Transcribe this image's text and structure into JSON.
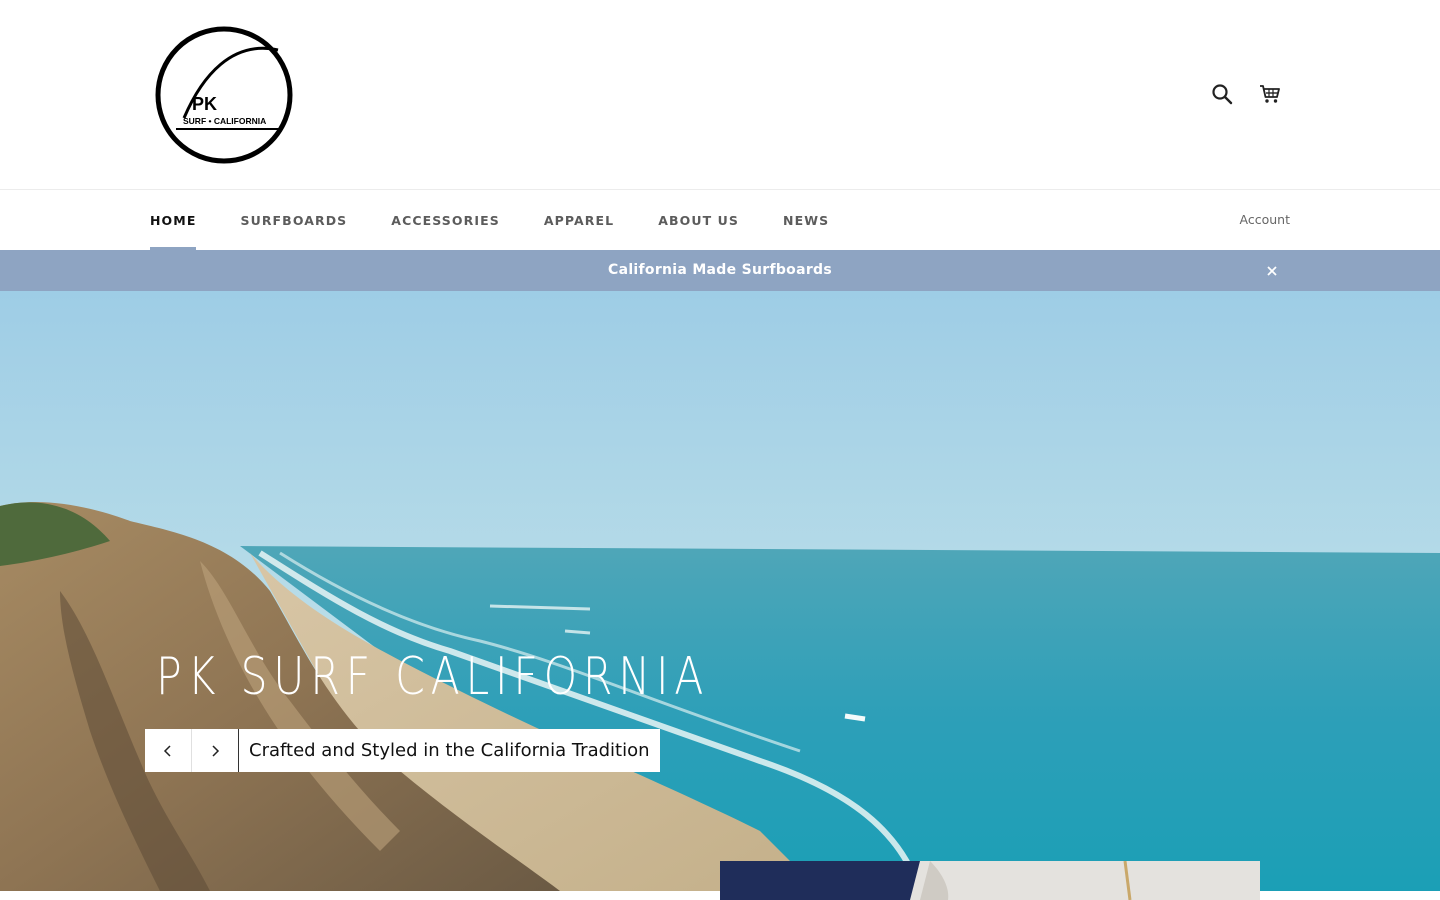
{
  "brand": {
    "logo_text": "PK",
    "logo_subtext": "SURF • CALIFORNIA"
  },
  "header": {
    "icons": [
      "search-icon",
      "cart-icon"
    ]
  },
  "nav": {
    "items": [
      {
        "label": "HOME",
        "active": true
      },
      {
        "label": "SURFBOARDS",
        "active": false
      },
      {
        "label": "ACCESSORIES",
        "active": false
      },
      {
        "label": "APPAREL",
        "active": false
      },
      {
        "label": "ABOUT US",
        "active": false
      },
      {
        "label": "NEWS",
        "active": false
      }
    ],
    "account_label": "Account"
  },
  "announcement": {
    "text": "California Made Surfboards",
    "close_icon": "close-icon"
  },
  "hero": {
    "title": "PK SURF CALIFORNIA",
    "subtitle": "Crafted and Styled in the California Tradition",
    "prev_icon": "chevron-left-icon",
    "next_icon": "chevron-right-icon"
  },
  "colors": {
    "accent": "#8ea4c2",
    "announcement_bg": "#8ea4c2",
    "nav_active": "#111111",
    "nav_text": "#5c5c5c"
  }
}
